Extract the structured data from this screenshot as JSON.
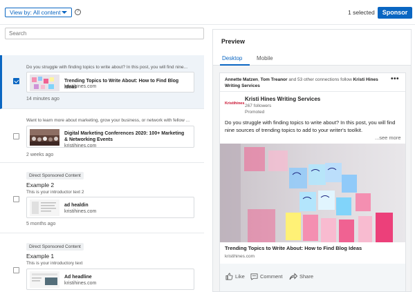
{
  "topbar": {
    "view_by_label": "View by: All content",
    "help_icon": "question-circle-icon",
    "selected_count_label": "1 selected",
    "sponsor_label": "Sponsor"
  },
  "search": {
    "placeholder": "Search"
  },
  "items": [
    {
      "checked": true,
      "intro_text": "Do you struggle with finding topics to write about? In this post, you will find nine...",
      "card_title": "Trending Topics to Write About: How to Find Blog Ideas",
      "card_domain": "kristihines.com",
      "time": "14 minutes ago"
    },
    {
      "checked": false,
      "intro_text": "Want to learn more about marketing, grow your business, or network with fellow ...",
      "card_title": "Digital Marketing Conferences 2020: 100+ Marketing & Networking Events",
      "card_domain": "kristihines.com",
      "time": "2 weeks ago"
    },
    {
      "checked": false,
      "badge": "Direct Sponsored Content",
      "title": "Example 2",
      "intro_text": "This is your introductor text 2",
      "card_title": "ad healdin",
      "card_domain": "kristihines.com",
      "time": "5 months ago"
    },
    {
      "checked": false,
      "badge": "Direct Sponsored Content",
      "title": "Example 1",
      "intro_text": "This is your introductory text",
      "card_title": "Ad headline",
      "card_domain": "kristihines.com"
    }
  ],
  "preview": {
    "title": "Preview",
    "tabs": [
      {
        "label": "Desktop",
        "active": true
      },
      {
        "label": "Mobile",
        "active": false
      }
    ],
    "social_line": {
      "name1": "Annette Matzen",
      "sep": ", ",
      "name2": "Tom Treanor",
      "middle": " and 53 other connections follow ",
      "company": "Kristi Hines Writing Services"
    },
    "more_icon": "more-dots-icon",
    "logo_text": "Kristihines",
    "company_name": "Kristi Hines Writing Services",
    "followers": "267 followers",
    "promoted": "Promoted",
    "post_text": "Do you struggle with finding topics to write about? In this post, you will find nine sources of trending topics to add to your writer's toolkit.",
    "see_more": "...see more",
    "link_title": "Trending Topics to Write About: How to Find Blog Ideas",
    "link_domain": "kristihines.com",
    "actions": [
      {
        "label": "Like",
        "icon": "thumbs-up-icon"
      },
      {
        "label": "Comment",
        "icon": "comment-icon"
      },
      {
        "label": "Share",
        "icon": "share-arrow-icon"
      }
    ]
  },
  "colors": {
    "accent": "#0a66c2",
    "selected_bg": "#eef3f8"
  }
}
